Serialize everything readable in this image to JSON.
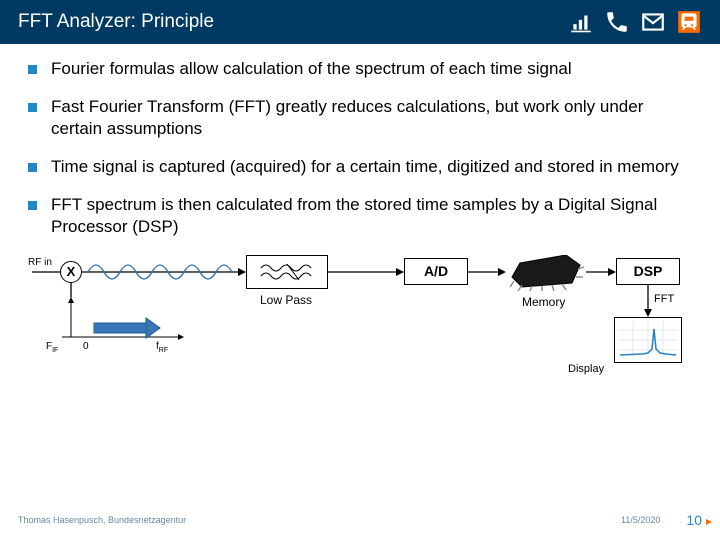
{
  "header": {
    "title": "FFT Analyzer: Principle"
  },
  "bullets": [
    "Fourier formulas allow calculation of the spectrum of each time signal",
    "Fast Fourier Transform (FFT) greatly reduces calculations, but work only under certain assumptions",
    "Time signal is captured (acquired) for a certain time, digitized and stored in memory",
    "FFT spectrum is then calculated from the stored time samples by a Digital Signal Processor (DSP)"
  ],
  "diagram": {
    "rf_in": "RF in",
    "mixer": "X",
    "f_if": "FIF",
    "zero": "0",
    "f_rf": "fRF",
    "low_pass": "Low Pass",
    "adc": "A/D",
    "dsp": "DSP",
    "memory": "Memory",
    "fft": "FFT",
    "display": "Display"
  },
  "footer": {
    "author": "Thomas Hasenpusch, Bundesnetzagentur",
    "date": "11/5/2020",
    "page": "10"
  }
}
